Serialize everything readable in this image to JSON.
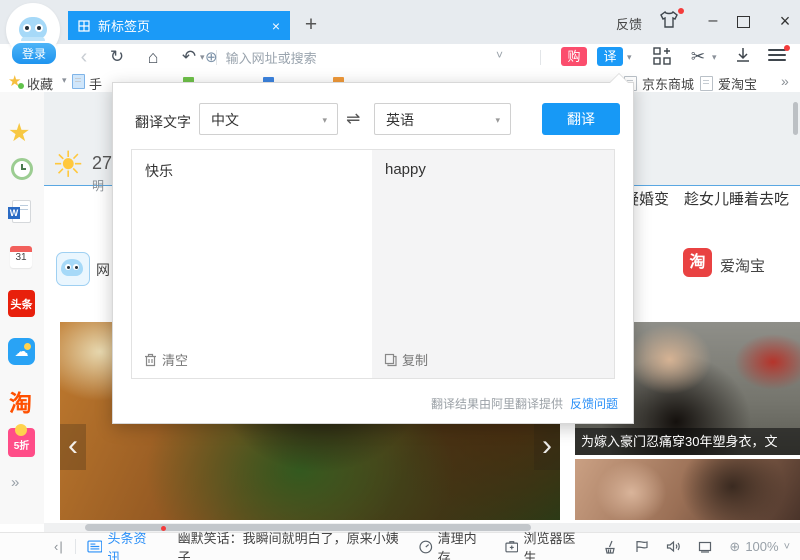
{
  "window": {
    "feedback_label": "反馈",
    "login_label": "登录",
    "minimize_glyph": "–",
    "close_glyph": "×"
  },
  "tabs": {
    "active_title": "新标签页",
    "close_glyph": "×",
    "new_tab_glyph": "+"
  },
  "toolbar": {
    "back_glyph": "‹",
    "refresh_glyph": "↻",
    "home_glyph": "⌂",
    "undo_glyph": "↶",
    "caret_glyph": "▾",
    "address_placeholder": "输入网址或搜索",
    "address_shield_glyph": "⊕",
    "address_caret": "˅",
    "buy_badge": "购",
    "translate_badge": "译",
    "scissors_glyph": "✂",
    "download_glyph": "↧"
  },
  "bookmarks": {
    "favorites_label": "收藏",
    "caret_glyph": "▾",
    "partial_item": "手",
    "jd_label": "京东商城",
    "aitao_label": "爱淘宝",
    "more_glyph": "»"
  },
  "sidebar": {
    "calendar_day": "31",
    "toutiao_label": "头条",
    "tao_label": "淘",
    "discount_label": "5折",
    "more_glyph": "»"
  },
  "page": {
    "temperature": "27",
    "weather_sub": "明",
    "nav_partial": "网",
    "headlines_right": "疑婚变　趁女儿睡着去吃",
    "aitao_card_icon": "淘",
    "aitao_card_label": "爱淘宝",
    "photo_caption": "为嫁入豪门忍痛穿30年塑身衣，文",
    "carousel_prev": "‹",
    "carousel_next": "›"
  },
  "translator": {
    "title_label": "翻译文字",
    "source_lang": "中文",
    "target_lang": "英语",
    "select_caret": "▾",
    "swap_glyph": "⇌",
    "translate_button": "翻译",
    "source_text": "快乐",
    "result_text": "happy",
    "clear_label": "清空",
    "copy_label": "复制",
    "credit_text": "翻译结果由阿里翻译提供",
    "feedback_link": "反馈问题"
  },
  "statusbar": {
    "collapse_glyph": "‹|",
    "toutiao_label": "头条资讯",
    "ticker_text": "幽默笑话：我瞬间就明白了，原来小姨子...",
    "clean_memory_label": "清理内存",
    "doctor_label": "浏览器医生",
    "zoom_glyph": "⊕",
    "zoom_level": "100%",
    "zoom_caret": "˅"
  },
  "colors": {
    "accent_blue": "#1b9af7",
    "buy_red": "#fb4d6d",
    "toutiao_red": "#e8200c",
    "taobao_orange": "#ff5000",
    "aitao_red": "#e94242",
    "discount_pink": "#ff4d88",
    "link_blue": "#2a8ff7"
  }
}
